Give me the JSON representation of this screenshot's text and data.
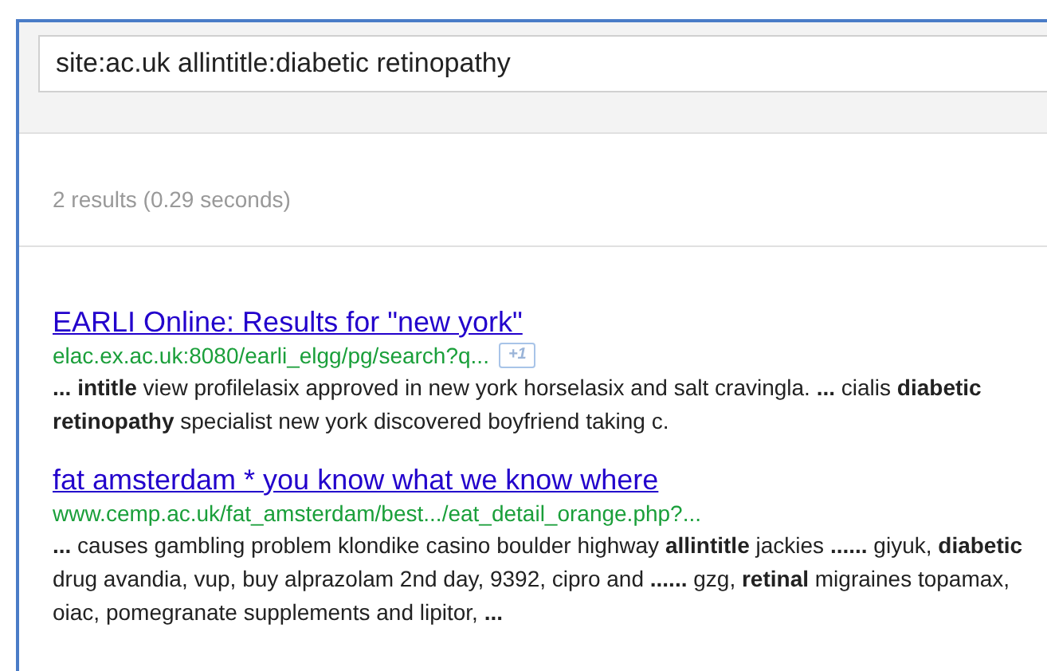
{
  "search": {
    "value": "site:ac.uk allintitle:diabetic retinopathy"
  },
  "result_stats": "2 results (0.29 seconds)",
  "results": [
    {
      "title": "EARLI Online: Results for \"new york\"",
      "url": "elac.ex.ac.uk:8080/earli_elgg/pg/search?q...",
      "plus_one": "+1",
      "snippet": "**...** **intitle** view profilelasix approved in new york horselasix and salt cravingla. **...** cialis **diabetic retinopathy** specialist new york discovered boyfriend taking c."
    },
    {
      "title": "fat amsterdam * you know what we know where",
      "url": "www.cemp.ac.uk/fat_amsterdam/best.../eat_detail_orange.php?...",
      "snippet": "**...** causes gambling problem klondike casino boulder highway **allintitle** jackies **......** giyuk, **diabetic** drug avandia, vup, buy alprazolam 2nd day, 9392, cipro and **......** gzg, **retinal** migraines topamax, oiac, pomegranate supplements and lipitor, **...**"
    }
  ]
}
